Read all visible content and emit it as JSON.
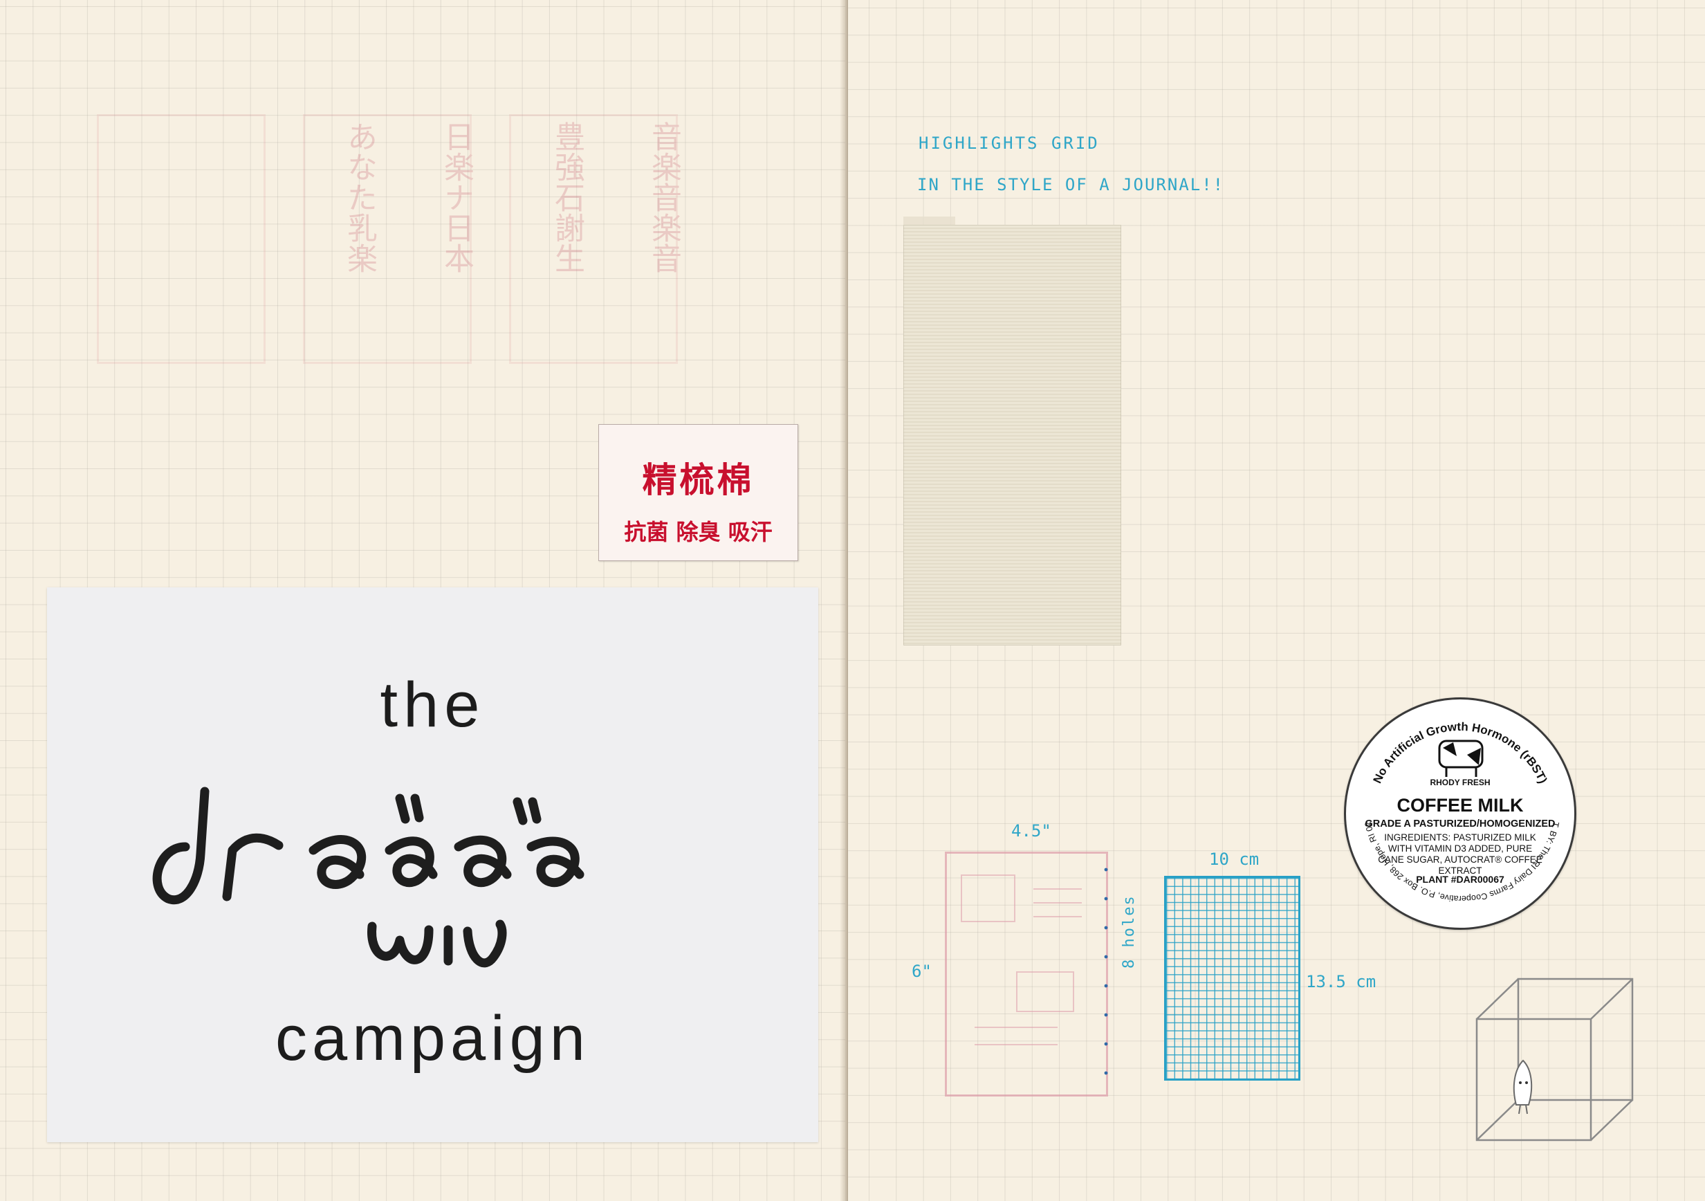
{
  "left_page": {
    "label_tag": {
      "line1": "精梳棉",
      "line2": "抗菌 除臭 吸汗",
      "color": "#c8102e"
    },
    "card": {
      "line_top": "the",
      "line_bottom": "campaign",
      "handwritten_mark": "handwritten script logo"
    },
    "faded_stamp_columns": [
      "音楽音楽音",
      "豊強石謝生",
      "日楽ナ日本",
      "あなた乳楽"
    ]
  },
  "right_page": {
    "heading_line1": "HIGHLIGHTS GRID",
    "heading_line2": "IN THE STYLE OF A JOURNAL!!",
    "measure_width": "4.5\"",
    "measure_height": "6\"",
    "holes_label": "8 holes",
    "grid_width_label": "10 cm",
    "grid_height_label": "13.5 cm",
    "ink_color": "#2fa6c8",
    "sticker": {
      "arc_text": "No Artificial Growth Hormone (rBST)",
      "brand": "RHODY FRESH",
      "title": "COFFEE MILK",
      "grade": "GRADE A PASTURIZED/HOMOGENIZED",
      "ingredients": "INGREDIENTS: PASTURIZED MILK WITH VITAMIN D3 ADDED, PURE CANE SUGAR, AUTOCRAT® COFFEE EXTRACT",
      "plant": "PLANT #DAR00067",
      "distributor": "DIST. BY: The RI Dairy Farms Cooperative, P.O. Box 268, Hope, RI 02831"
    }
  }
}
